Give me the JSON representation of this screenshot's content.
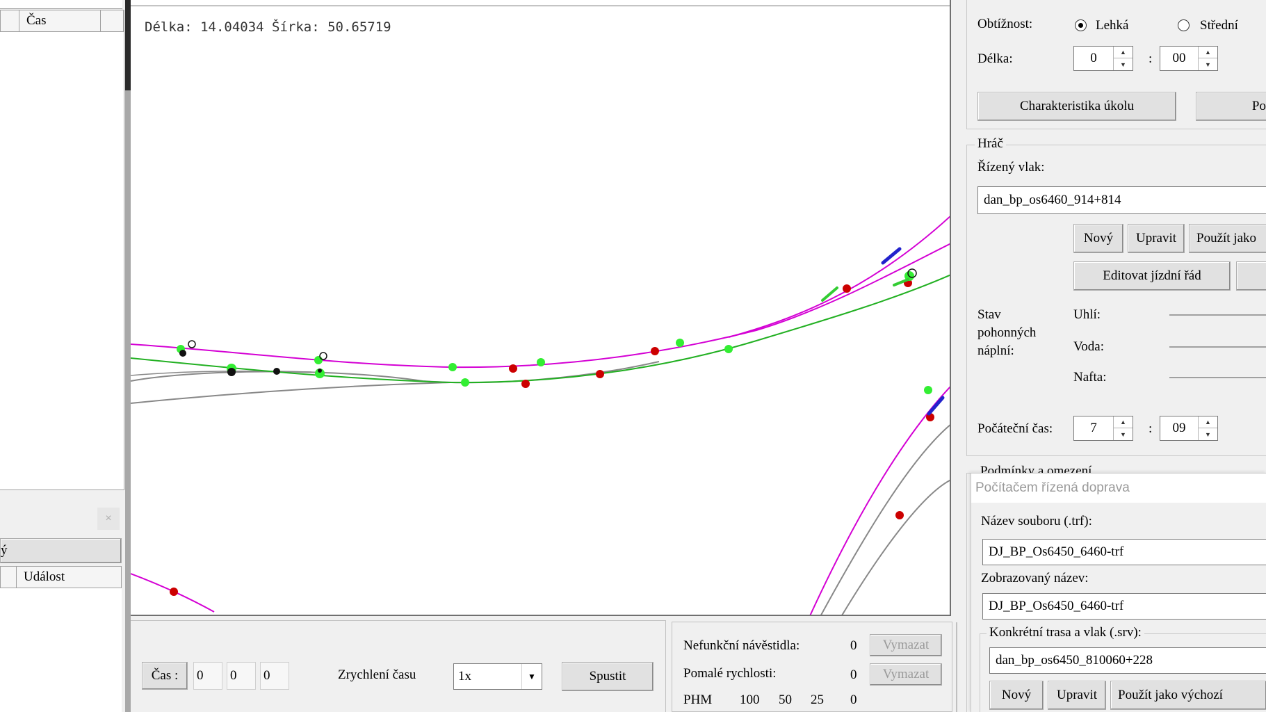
{
  "left_panel": {
    "top_column_label": "Čas",
    "bottom_tab_label": "ý",
    "bottom_column_label": "Událost",
    "close_symbol": "×"
  },
  "map": {
    "coords_text": "Délka: 14.04034 Šírka: 50.65719"
  },
  "bottom_bar": {
    "time_label": "Čas :",
    "time_h": "0",
    "time_m": "0",
    "time_s": "0",
    "speed_label": "Zrychlení času",
    "speed_value": "1x",
    "start_label": "Spustit"
  },
  "stats": {
    "signals_label": "Nefunkční návěstidla:",
    "signals_count": "0",
    "slow_label": "Pomalé rychlosti:",
    "slow_count": "0",
    "clear_label": "Vymazat",
    "phm_label": "PHM",
    "phm_values": [
      "100",
      "50",
      "25",
      "0"
    ]
  },
  "right_panel": {
    "difficulty_label": "Obtížnost:",
    "difficulty_easy": "Lehká",
    "difficulty_medium": "Střední",
    "length_label": "Délka:",
    "length_h": "0",
    "length_m": "00",
    "colon": ":",
    "task_button": "Charakteristika úkolu",
    "cut_button": "Po",
    "player_group": "Hráč",
    "train_label": "Řízený vlak:",
    "train_value": "dan_bp_os6460_914+814",
    "new_button": "Nový",
    "edit_button": "Upravit",
    "use_as_button": "Použít jako",
    "timetable_button": "Editovat jízdní řád",
    "fuel_label": "Stav pohonných náplní:",
    "coal_label": "Uhlí:",
    "water_label": "Voda:",
    "diesel_label": "Nafta:",
    "start_time_label": "Počáteční čas:",
    "start_time_h": "7",
    "start_time_m": "09",
    "conditions_group": "Podmínky a omezení"
  },
  "traffic_panel": {
    "title": "Počítačem řízená doprava",
    "file_label": "Název souboru (.trf):",
    "file_value": "DJ_BP_Os6450_6460-trf",
    "display_label": "Zobrazovaný název:",
    "display_value": "DJ_BP_Os6450_6460-trf",
    "route_group": "Konkrétní trasa a vlak (.srv):",
    "route_value": "dan_bp_os6450_810060+228",
    "new_button": "Nový",
    "edit_button": "Upravit",
    "default_button": "Použít jako výchozí"
  },
  "colors": {
    "route_magenta": "#d400d4",
    "route_green": "#22b022",
    "signal_red": "#cc0000",
    "signal_green": "#33ee33",
    "train_blue": "#2222cc"
  }
}
